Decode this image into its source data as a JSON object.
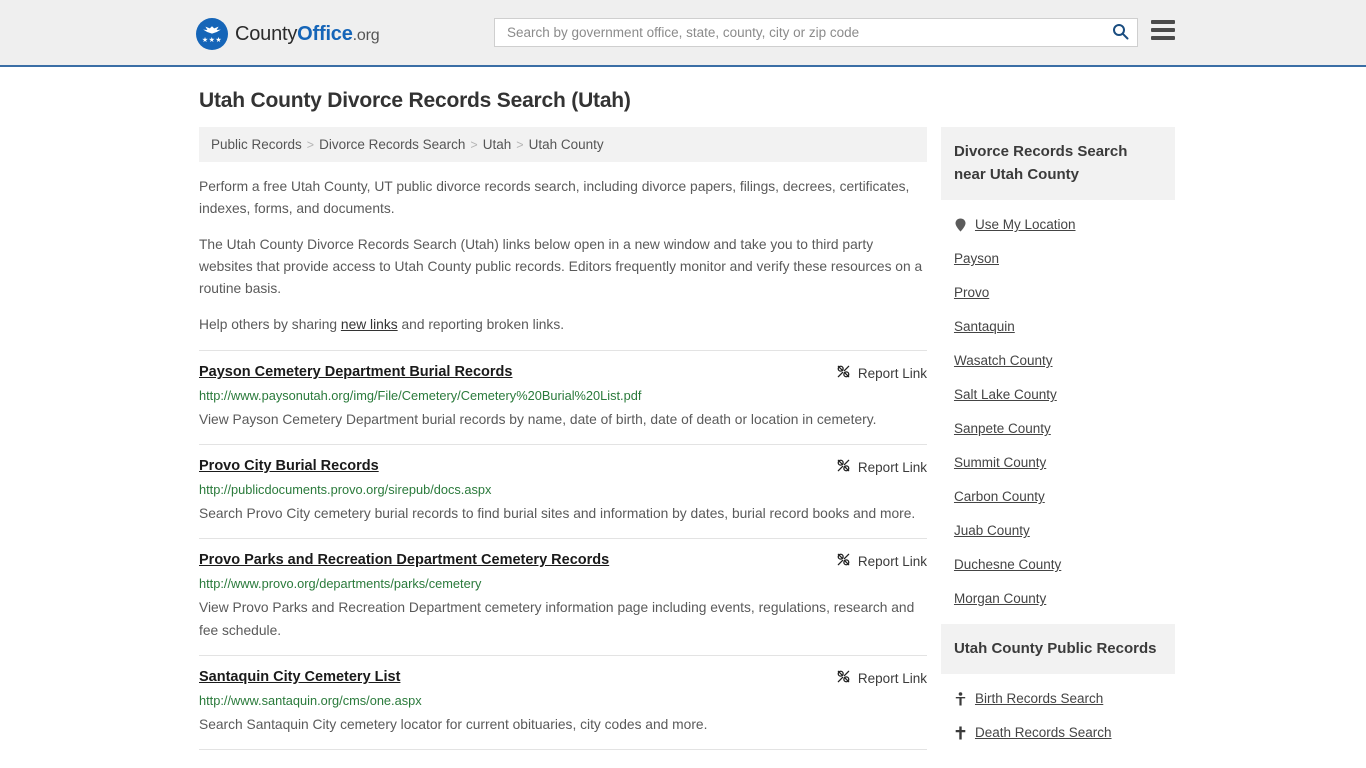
{
  "header": {
    "logo": {
      "part1": "County",
      "part2": "Office",
      "part3": ".org",
      "icon": "eagle-seal-icon"
    },
    "search": {
      "placeholder": "Search by government office, state, county, city or zip code",
      "value": "",
      "icon": "search-icon"
    },
    "menu_icon": "hamburger-menu-icon",
    "accent_color": "#1565b8",
    "border_color": "#3a6ea5",
    "background": "#efefef"
  },
  "page_title": "Utah County Divorce Records Search (Utah)",
  "breadcrumb": {
    "items": [
      {
        "label": "Public Records"
      },
      {
        "label": "Divorce Records Search"
      },
      {
        "label": "Utah"
      },
      {
        "label": "Utah County"
      }
    ],
    "separator": ">"
  },
  "intro": {
    "p1": "Perform a free Utah County, UT public divorce records search, including divorce papers, filings, decrees, certificates, indexes, forms, and documents.",
    "p2": "The Utah County Divorce Records Search (Utah) links below open in a new window and take you to third party websites that provide access to Utah County public records. Editors frequently monitor and verify these resources on a routine basis.",
    "p3_before": "Help others by sharing ",
    "p3_link": "new links",
    "p3_after": " and reporting broken links."
  },
  "results": {
    "report_label": "Report Link",
    "report_icon": "broken-link-icon",
    "items": [
      {
        "title": "Payson Cemetery Department Burial Records",
        "url": "http://www.paysonutah.org/img/File/Cemetery/Cemetery%20Burial%20List.pdf",
        "description": "View Payson Cemetery Department burial records by name, date of birth, date of death or location in cemetery."
      },
      {
        "title": "Provo City Burial Records",
        "url": "http://publicdocuments.provo.org/sirepub/docs.aspx",
        "description": "Search Provo City cemetery burial records to find burial sites and information by dates, burial record books and more."
      },
      {
        "title": "Provo Parks and Recreation Department Cemetery Records",
        "url": "http://www.provo.org/departments/parks/cemetery",
        "description": "View Provo Parks and Recreation Department cemetery information page including events, regulations, research and fee schedule."
      },
      {
        "title": "Santaquin City Cemetery List",
        "url": "http://www.santaquin.org/cms/one.aspx",
        "description": "Search Santaquin City cemetery locator for current obituaries, city codes and more."
      }
    ]
  },
  "sidebar": {
    "nearby": {
      "title": "Divorce Records Search near Utah County",
      "items": [
        {
          "label": "Use My Location",
          "icon": "location-pin-icon"
        },
        {
          "label": "Payson",
          "icon": ""
        },
        {
          "label": "Provo",
          "icon": ""
        },
        {
          "label": "Santaquin",
          "icon": ""
        },
        {
          "label": "Wasatch County",
          "icon": ""
        },
        {
          "label": "Salt Lake County",
          "icon": ""
        },
        {
          "label": "Sanpete County",
          "icon": ""
        },
        {
          "label": "Summit County",
          "icon": ""
        },
        {
          "label": "Carbon County",
          "icon": ""
        },
        {
          "label": "Juab County",
          "icon": ""
        },
        {
          "label": "Duchesne County",
          "icon": ""
        },
        {
          "label": "Morgan County",
          "icon": ""
        }
      ]
    },
    "public_records": {
      "title": "Utah County Public Records",
      "items": [
        {
          "label": "Birth Records Search",
          "icon": "baby-icon"
        },
        {
          "label": "Death Records Search",
          "icon": "cross-icon"
        }
      ]
    }
  }
}
